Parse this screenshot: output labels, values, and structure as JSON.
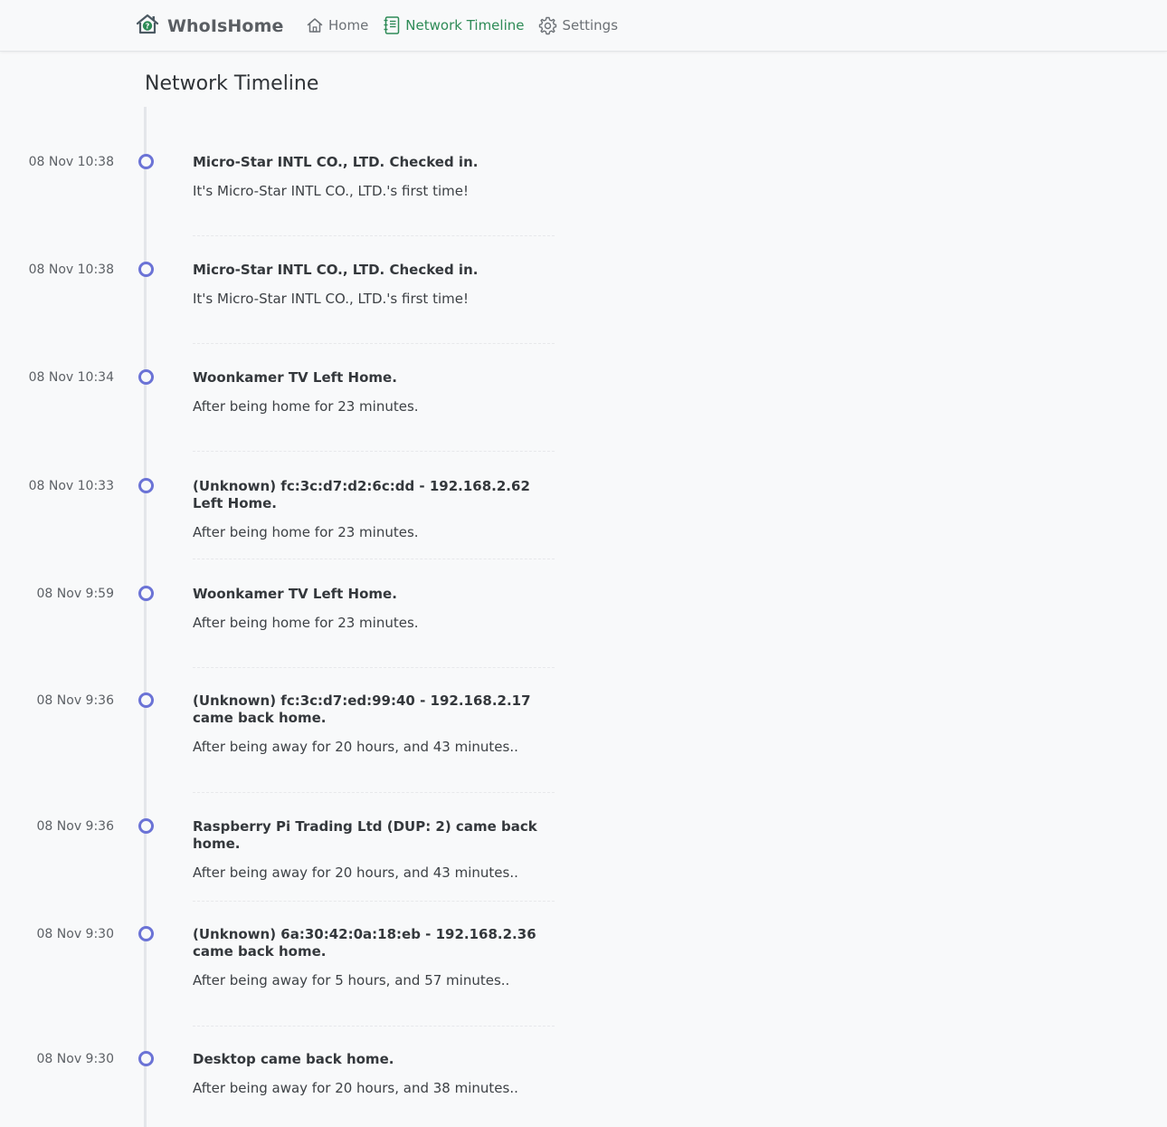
{
  "navbar": {
    "brand": "WhoIsHome",
    "brand_icon": "house-question-icon",
    "items": [
      {
        "label": "Home",
        "icon": "house-icon",
        "active": false
      },
      {
        "label": "Network Timeline",
        "icon": "journal-icon",
        "active": true
      },
      {
        "label": "Settings",
        "icon": "gear-icon",
        "active": false
      }
    ],
    "active_color": "#2e8b57"
  },
  "page": {
    "title": "Network Timeline"
  },
  "timeline": {
    "dot_color": "#6b73d6",
    "events": [
      {
        "time": "08 Nov 10:38",
        "title": "Micro-Star INTL CO., LTD. Checked in.",
        "description": "It's Micro-Star INTL CO., LTD.'s first time!"
      },
      {
        "time": "08 Nov 10:38",
        "title": "Micro-Star INTL CO., LTD. Checked in.",
        "description": "It's Micro-Star INTL CO., LTD.'s first time!"
      },
      {
        "time": "08 Nov 10:34",
        "title": "Woonkamer TV Left Home.",
        "description": "After being home for 23 minutes."
      },
      {
        "time": "08 Nov 10:33",
        "title": "(Unknown) fc:3c:d7:d2:6c:dd - 192.168.2.62 Left Home.",
        "description": "After being home for 23 minutes."
      },
      {
        "time": "08 Nov 9:59",
        "title": "Woonkamer TV Left Home.",
        "description": "After being home for 23 minutes."
      },
      {
        "time": "08 Nov 9:36",
        "title": "(Unknown) fc:3c:d7:ed:99:40 - 192.168.2.17 came back home.",
        "description": "After being away for 20 hours, and 43 minutes.."
      },
      {
        "time": "08 Nov 9:36",
        "title": "Raspberry Pi Trading Ltd (DUP: 2) came back home.",
        "description": "After being away for 20 hours, and 43 minutes.."
      },
      {
        "time": "08 Nov 9:30",
        "title": "(Unknown) 6a:30:42:0a:18:eb - 192.168.2.36 came back home.",
        "description": "After being away for 5 hours, and 57 minutes.."
      },
      {
        "time": "08 Nov 9:30",
        "title": "Desktop came back home.",
        "description": "After being away for 20 hours, and 38 minutes.."
      }
    ]
  }
}
